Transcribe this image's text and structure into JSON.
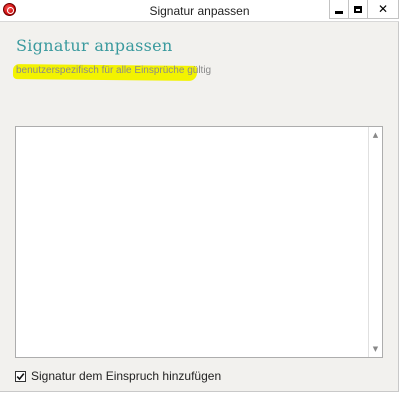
{
  "window": {
    "title": "Signatur anpassen",
    "controls": {
      "minimize": "",
      "maximize": "",
      "close": "✕"
    }
  },
  "main": {
    "heading": "Signatur anpassen",
    "subtext": "benutzerspezifisch für alle Einsprüche gültig",
    "highlight_color": "#f3f300",
    "signature_text": "",
    "checkbox": {
      "label": "Signatur dem Einspruch hinzufügen",
      "checked": true
    }
  },
  "icons": {
    "app": "app-icon",
    "scroll_up": "chevron-up-icon",
    "scroll_down": "chevron-down-icon",
    "check": "check-icon"
  },
  "colors": {
    "heading": "#3a9a9e",
    "subtext": "#8a8a8a",
    "window_bg": "#f2f1ee"
  }
}
